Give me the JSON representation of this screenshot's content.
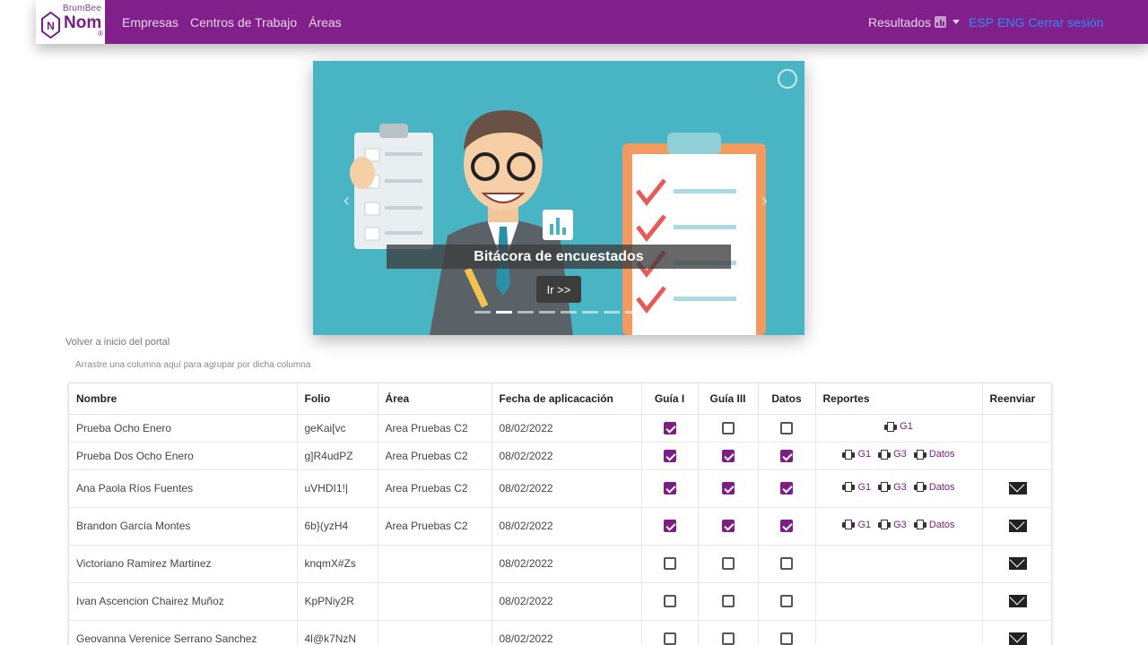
{
  "brand": {
    "small": "BrumBee",
    "big": "Nom",
    "badge_letter": "N",
    "reg": "®"
  },
  "nav": {
    "links": [
      "Empresas",
      "Centros de Trabajo",
      "Áreas"
    ],
    "results": "Resultados",
    "lang_es": "ESP",
    "lang_en": "ENG",
    "logout": "Cerrar sesión"
  },
  "hero": {
    "caption": "Bitácora de encuestados",
    "button": "Ir >>",
    "active_slide": 1,
    "slide_count": 8
  },
  "back_link": "Volver a inicio del portal",
  "group_hint": "Arrastre una columna aquí para agrupar por dicha columna",
  "table": {
    "columns": [
      "Nombre",
      "Folio",
      "Área",
      "Fecha de aplicacación",
      "Guía I",
      "Guía III",
      "Datos",
      "Reportes",
      "Reenviar"
    ],
    "rows": [
      {
        "name": "Prueba Ocho Enero",
        "folio": "geKai[vc",
        "area": "Area Pruebas C2",
        "date": "08/02/2022",
        "g1": true,
        "g3": false,
        "datos": false,
        "reports": [
          "G1"
        ],
        "resend": false
      },
      {
        "name": "Prueba Dos Ocho Enero",
        "folio": "g]R4udPZ",
        "area": "Area Pruebas C2",
        "date": "08/02/2022",
        "g1": true,
        "g3": true,
        "datos": true,
        "reports": [
          "G1",
          "G3",
          "Datos"
        ],
        "resend": false
      },
      {
        "name": "Ana Paola Ríos Fuentes",
        "folio": "uVHDI1!|",
        "area": "Area Pruebas C2",
        "date": "08/02/2022",
        "g1": true,
        "g3": true,
        "datos": true,
        "reports": [
          "G1",
          "G3",
          "Datos"
        ],
        "resend": true
      },
      {
        "name": "Brandon García Montes",
        "folio": "6b}(yzH4",
        "area": "Area Pruebas C2",
        "date": "08/02/2022",
        "g1": true,
        "g3": true,
        "datos": true,
        "reports": [
          "G1",
          "G3",
          "Datos"
        ],
        "resend": true
      },
      {
        "name": "Victoriano Ramirez Martinez",
        "folio": "knqmX#Zs",
        "area": "",
        "date": "08/02/2022",
        "g1": false,
        "g3": false,
        "datos": false,
        "reports": [],
        "resend": true
      },
      {
        "name": "Ivan Ascencion Chairez Muñoz",
        "folio": "KpPNiy2R",
        "area": "",
        "date": "08/02/2022",
        "g1": false,
        "g3": false,
        "datos": false,
        "reports": [],
        "resend": true
      },
      {
        "name": "Geovanna Verenice Serrano Sanchez",
        "folio": "4l@k7NzN",
        "area": "",
        "date": "08/02/2022",
        "g1": false,
        "g3": false,
        "datos": false,
        "reports": [],
        "resend": true
      }
    ]
  },
  "colors": {
    "brand": "#81208a",
    "accent": "#7d1e87",
    "hero_bg": "#49b5c4",
    "link_blue": "#2e8cff"
  }
}
